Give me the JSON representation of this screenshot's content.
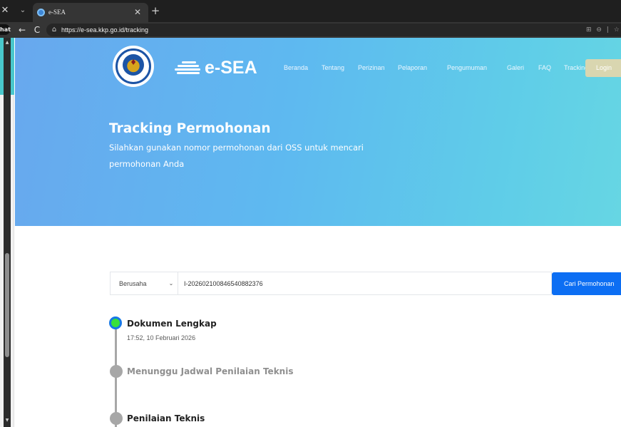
{
  "browser": {
    "close_glyph": "✕",
    "tab_list_glyph": "⌄",
    "tab": {
      "favicon": "esea-favicon",
      "title": "e-SEA",
      "close_glyph": "✕"
    },
    "new_tab_glyph": "+",
    "side_tab_label": "hat",
    "back_glyph": "←",
    "reload_glyph": "C",
    "site_info_glyph": "⌂",
    "url": "https://e-sea.kkp.go.id/tracking",
    "toolbar_icons": "⊞ ⊖ | ☆",
    "accent": "#3d86d6"
  },
  "sidebar": {
    "scroll_up_glyph": "▲",
    "scroll_down_glyph": "▼"
  },
  "header": {
    "brand_name": "e-SEA",
    "seal_emblem": "kkp-seal",
    "nav": [
      "Beranda",
      "Tentang",
      "Perizinan",
      "Pelaporan",
      "Pengumuman",
      "Galeri",
      "FAQ",
      "Tracking"
    ],
    "login_label": "Login"
  },
  "hero": {
    "title": "Tracking Permohonan",
    "subtitle": "Silahkan gunakan nomor permohonan dari OSS untuk mencari permohonan Anda",
    "gradient": [
      "#68a8ee",
      "#66d6e3"
    ]
  },
  "search": {
    "type_selected": "Berusaha",
    "type_chevron": "⌄",
    "query_value": "I-202602100846540882376",
    "button_label": "Cari Permohonan",
    "button_color": "#0c6ef3"
  },
  "timeline": {
    "steps": [
      {
        "title": "Dokumen Lengkap",
        "time": "17:52, 10 Februari 2026",
        "status": "done"
      },
      {
        "title": "Menunggu Jadwal Penilaian Teknis",
        "time": "",
        "status": "pending"
      },
      {
        "title": "Penilaian Teknis",
        "time": "",
        "status": "pending"
      }
    ],
    "done_color": "#38e03a",
    "pending_color": "#a7a7a7"
  }
}
